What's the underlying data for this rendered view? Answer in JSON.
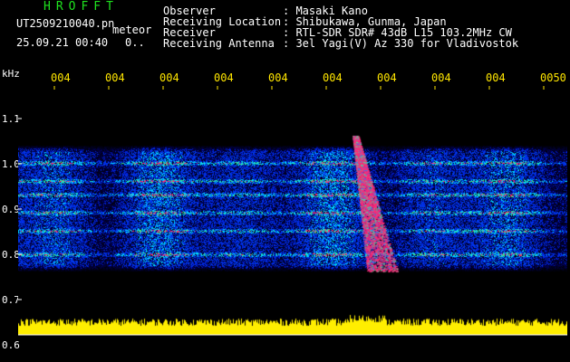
{
  "title": "HROFFT",
  "file_name": "UT2509210040.pn",
  "subtitle": "meteor",
  "datetime": "25.09.21 00:40",
  "counter": "0..",
  "info": [
    {
      "label": "Observer",
      "value": ": Masaki Kano"
    },
    {
      "label": "Receiving Location",
      "value": ": Shibukawa, Gunma, Japan"
    },
    {
      "label": "Receiver",
      "value": ": RTL-SDR SDR# 43dB L15 103.2MHz CW"
    },
    {
      "label": "Receiving Antenna",
      "value": ": 3el Yagi(V) Az 330 for Vladivostok"
    }
  ],
  "time_ticks": [
    "004",
    "004",
    "004",
    "004",
    "004",
    "004",
    "004",
    "004",
    "004",
    "0050"
  ],
  "freq_unit": "kHz",
  "freq_labels": [
    "1.1",
    "1.0",
    "0.9",
    "0.8",
    "0.7",
    "0.6"
  ],
  "colors": {
    "signal": "#ff1f6e",
    "noise": "#1a3cff",
    "baseline": "#ffee00",
    "tick": "#ffe600"
  }
}
